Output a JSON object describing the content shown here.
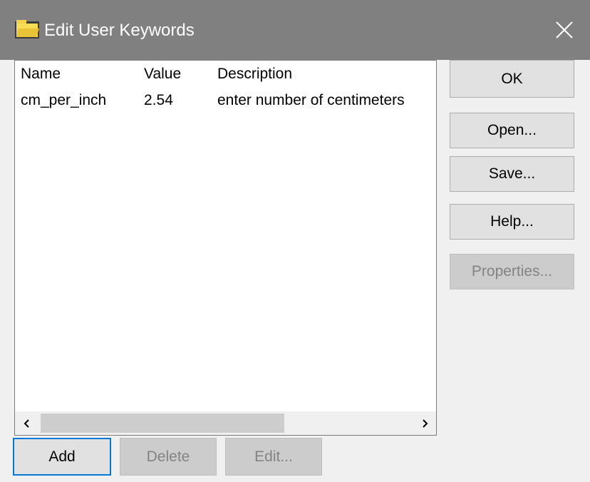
{
  "window": {
    "title": "Edit User Keywords"
  },
  "list": {
    "columns": [
      "Name",
      "Value",
      "Description"
    ],
    "rows": [
      {
        "name": "cm_per_inch",
        "value": "2.54",
        "description": "enter number of centimeters"
      }
    ]
  },
  "buttons": {
    "ok": "OK",
    "open": "Open...",
    "save": "Save...",
    "help": "Help...",
    "properties": "Properties...",
    "add": "Add",
    "delete": "Delete",
    "edit": "Edit..."
  },
  "colors": {
    "titlebar": "#808080",
    "focus_border": "#0078d7",
    "disabled_text": "#838383"
  },
  "icons": {
    "title": "folder-icon",
    "close": "close-icon",
    "scroll_left": "chevron-left-icon",
    "scroll_right": "chevron-right-icon"
  }
}
